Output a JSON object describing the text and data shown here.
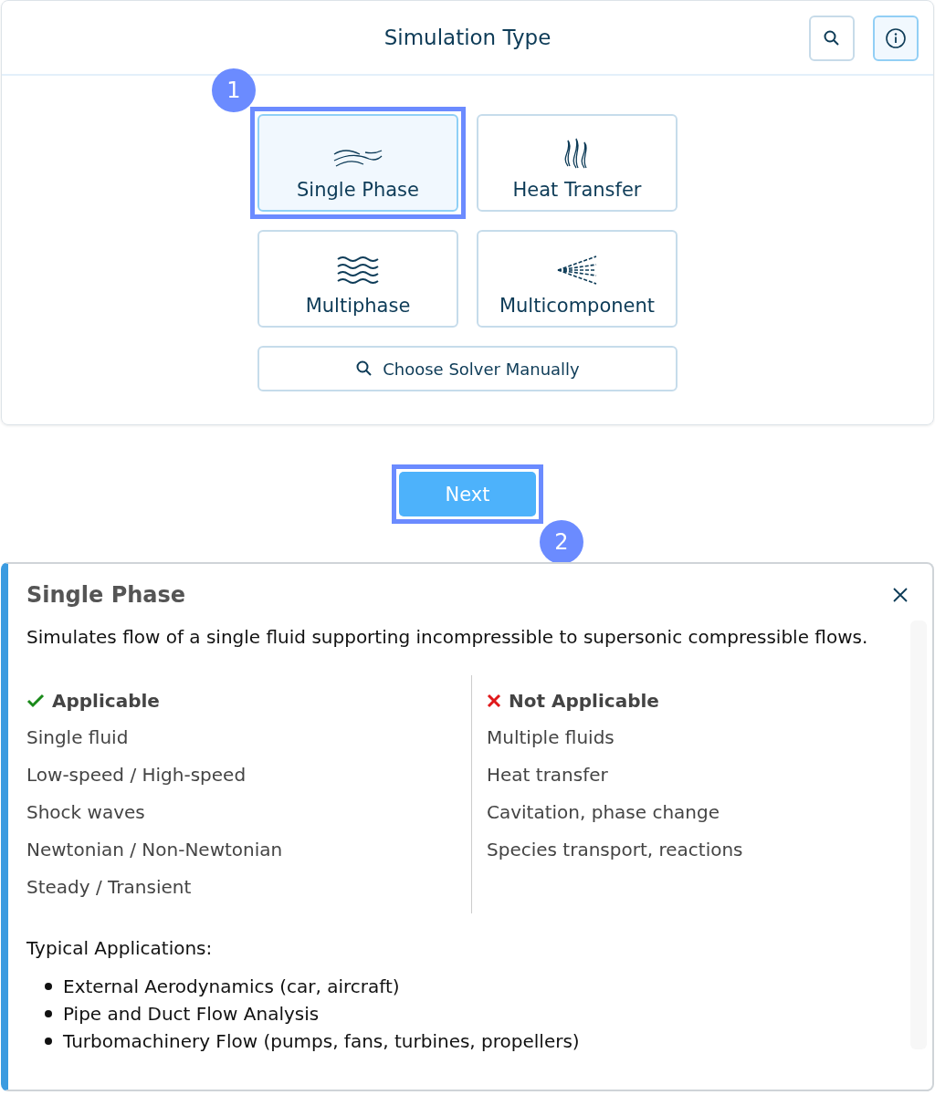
{
  "header": {
    "title": "Simulation Type"
  },
  "options": [
    {
      "label": "Single Phase",
      "kind": "streams",
      "selected": true,
      "callout": "1"
    },
    {
      "label": "Heat Transfer",
      "kind": "flames",
      "selected": false
    },
    {
      "label": "Multiphase",
      "kind": "waves",
      "selected": false
    },
    {
      "label": "Multicomponent",
      "kind": "spray",
      "selected": false
    }
  ],
  "manual_button": {
    "label": "Choose Solver Manually"
  },
  "next_button": {
    "label": "Next",
    "callout": "2"
  },
  "details": {
    "title": "Single Phase",
    "description": "Simulates flow of a single fluid supporting incompressible to supersonic compressible flows.",
    "columns": [
      {
        "kind": "yes",
        "heading": "Applicable",
        "items": [
          "Single fluid",
          "Low-speed / High-speed",
          "Shock waves",
          "Newtonian / Non-Newtonian",
          "Steady / Transient"
        ]
      },
      {
        "kind": "no",
        "heading": "Not Applicable",
        "items": [
          "Multiple fluids",
          "Heat transfer",
          "Cavitation, phase change",
          "Species transport, reactions"
        ]
      }
    ],
    "applications_heading": "Typical Applications:",
    "applications": [
      "External Aerodynamics (car, aircraft)",
      "Pipe and Duct Flow Analysis",
      "Turbomachinery Flow (pumps, fans, turbines, propellers)"
    ]
  }
}
